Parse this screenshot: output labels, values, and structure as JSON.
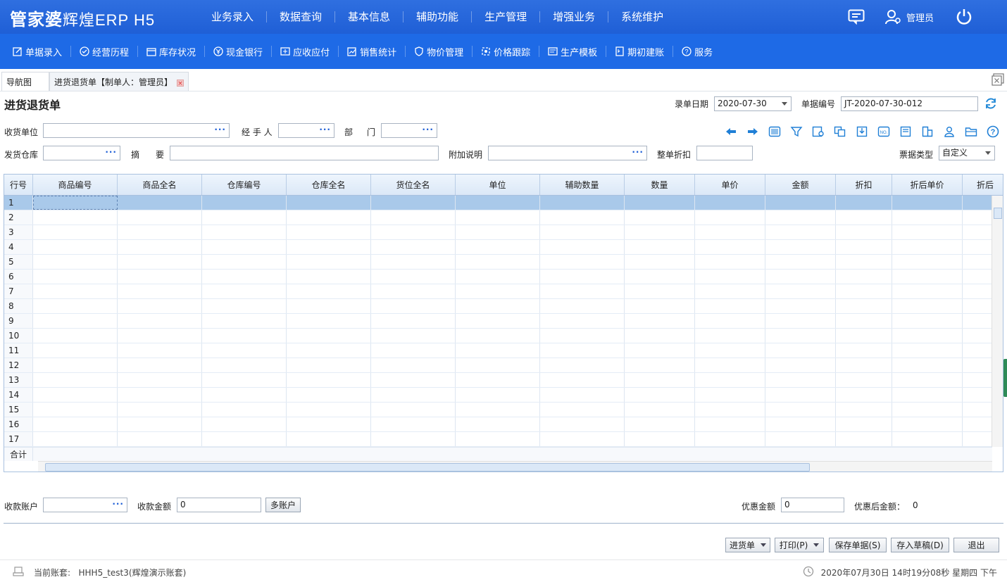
{
  "app": {
    "logo_main": "管家婆",
    "logo_sub": "辉煌ERP H5",
    "user": "管理员"
  },
  "main_nav": [
    "业务录入",
    "数据查询",
    "基本信息",
    "辅助功能",
    "生产管理",
    "增强业务",
    "系统维护"
  ],
  "sub_nav": [
    "单据录入",
    "经营历程",
    "库存状况",
    "现金银行",
    "应收应付",
    "销售统计",
    "物价管理",
    "价格跟踪",
    "生产模板",
    "期初建账",
    "服务"
  ],
  "tabs": {
    "nav": "导航图",
    "doc": "进货退货单【制单人：管理员】"
  },
  "form": {
    "title": "进货退货单",
    "date_label": "录单日期",
    "date_value": "2020-07-30",
    "docno_label": "单据编号",
    "docno_value": "JT-2020-07-30-012",
    "receiver_label": "收货单位",
    "receiver_value": "",
    "handler_label": "经 手 人",
    "handler_value": "",
    "dept_label_1": "部",
    "dept_label_2": "门",
    "dept_value": "",
    "warehouse_label": "发货仓库",
    "warehouse_value": "",
    "summary_label_1": "摘",
    "summary_label_2": "要",
    "summary_value": "",
    "note_label": "附加说明",
    "note_value": "",
    "discount_label": "整单折扣",
    "discount_value": "",
    "invoice_label": "票据类型",
    "invoice_value": "自定义"
  },
  "toolbar_icons": [
    "arrow-left-icon",
    "arrow-right-icon",
    "barcode-icon",
    "filter-icon",
    "settings-doc-icon",
    "copy-icon",
    "import-icon",
    "serial-no-icon",
    "save-doc-icon",
    "chart-doc-icon",
    "user-icon",
    "folder-icon",
    "help-icon"
  ],
  "grid": {
    "columns": [
      "行号",
      "商品编号",
      "商品全名",
      "仓库编号",
      "仓库全名",
      "货位全名",
      "单位",
      "辅助数量",
      "数量",
      "单价",
      "金额",
      "折扣",
      "折后单价",
      "折后"
    ],
    "rows": [
      "1",
      "2",
      "3",
      "4",
      "5",
      "6",
      "7",
      "8",
      "9",
      "10",
      "11",
      "12",
      "13",
      "14",
      "15",
      "16",
      "17"
    ],
    "total_label": "合计"
  },
  "payment": {
    "account_label": "收款账户",
    "account_value": "",
    "amount_label": "收款金额",
    "amount_value": "0",
    "multi_button": "多账户",
    "discount_amount_label": "优惠金额",
    "discount_amount_value": "0",
    "after_discount_label": "优惠后金额：",
    "after_discount_value": "0"
  },
  "actions": {
    "purchase": "进货单",
    "print": "打印(P)",
    "save": "保存单据(S)",
    "draft": "存入草稿(D)",
    "exit": "退出"
  },
  "status": {
    "account_label": "当前账套:",
    "account_value": "HHH5_test3(辉煌演示账套)",
    "datetime": "2020年07月30日 14时19分08秒 星期四 下午"
  },
  "colors": {
    "topbar": "#2f6fe0",
    "subbar": "#1e6ae6",
    "accent": "#1f5fd6",
    "row_selected": "#a9c9ea"
  }
}
